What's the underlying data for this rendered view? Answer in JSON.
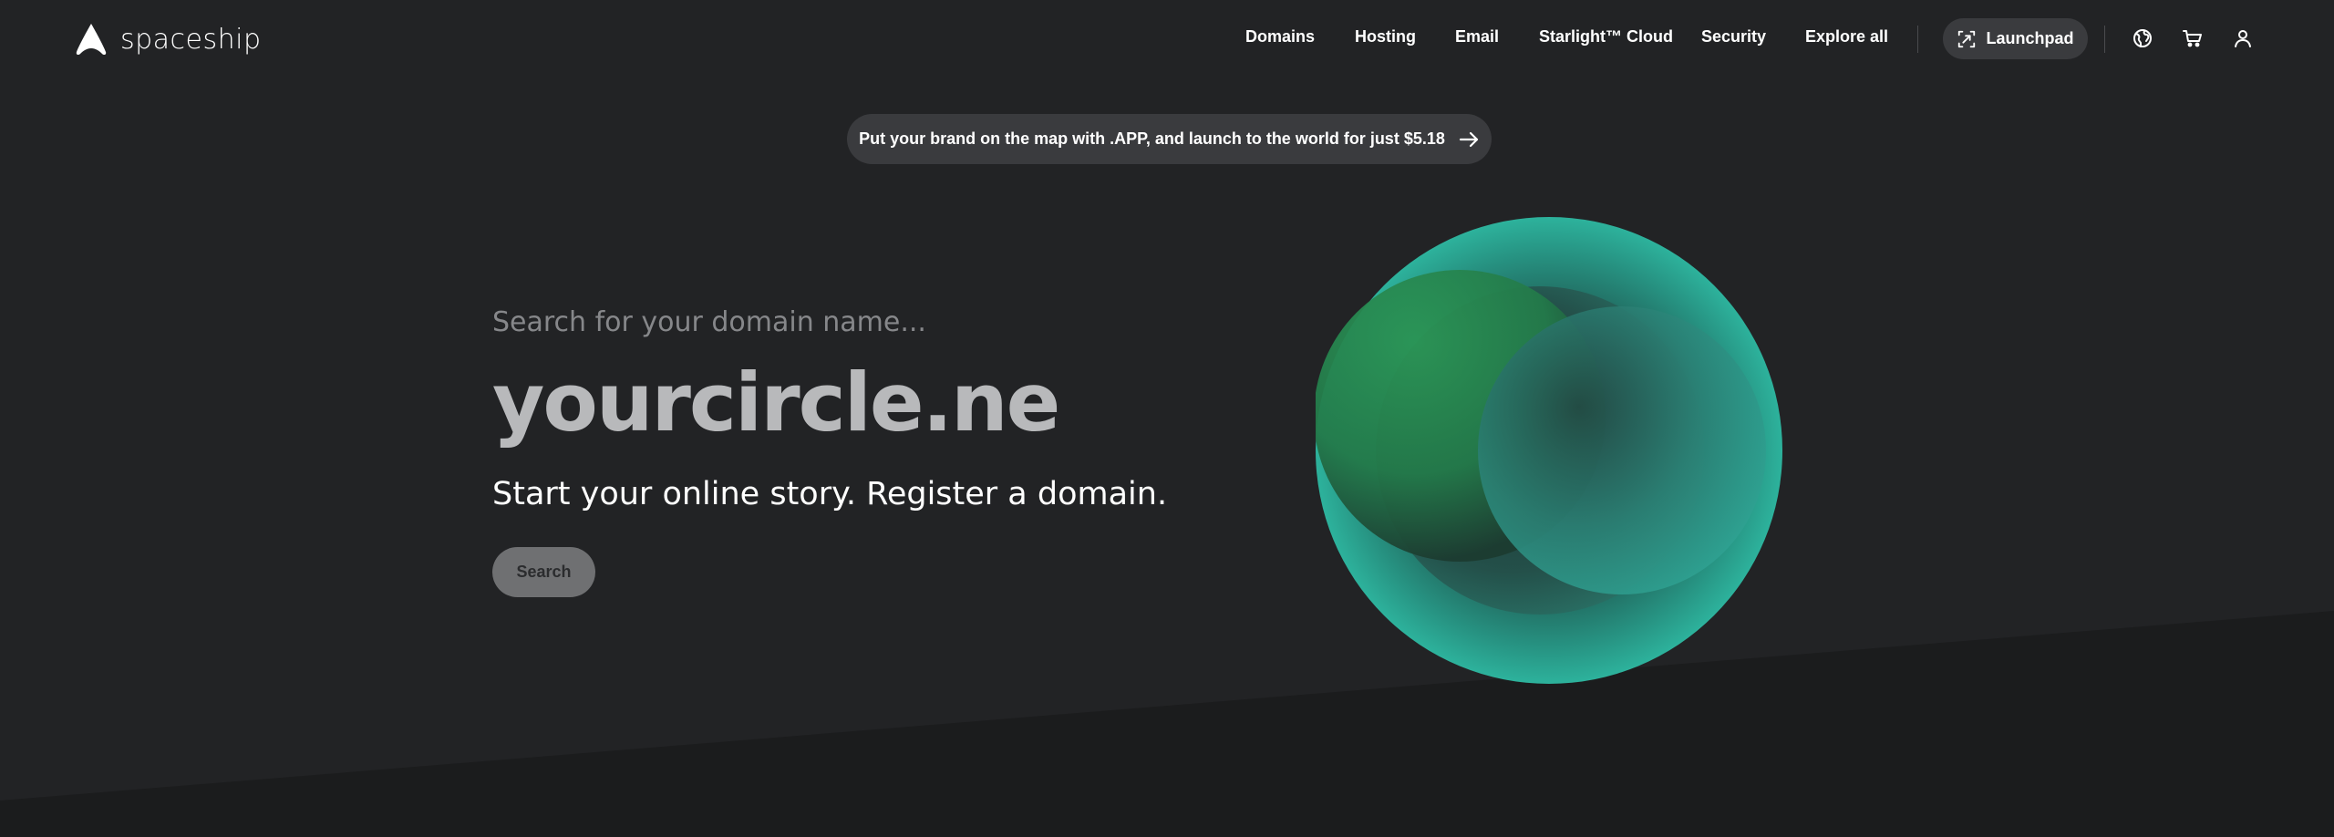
{
  "brand": {
    "name": "spaceship"
  },
  "nav": {
    "items": [
      {
        "label": "Domains"
      },
      {
        "label": "Hosting"
      },
      {
        "label": "Email"
      },
      {
        "label": "Starlight™ Cloud"
      },
      {
        "label": "Security"
      },
      {
        "label": "Explore all"
      }
    ],
    "launchpad_label": "Launchpad",
    "icons": [
      "globe-icon",
      "cart-icon",
      "user-icon"
    ]
  },
  "promo": {
    "text": "Put your brand on the map with .APP, and launch to the world for just $5.18",
    "icon": "arrow-right-icon"
  },
  "hero": {
    "placeholder": "Search for your domain name...",
    "typed_domain": "yourcircle.ne",
    "tagline": "Start your online story. Register a domain.",
    "search_label": "Search"
  },
  "colors": {
    "background": "#222325",
    "bottom_band": "#1b1c1d",
    "pill": "#3a3b3e",
    "orb_teal": "#2aa592",
    "orb_green": "#2b8f58"
  }
}
